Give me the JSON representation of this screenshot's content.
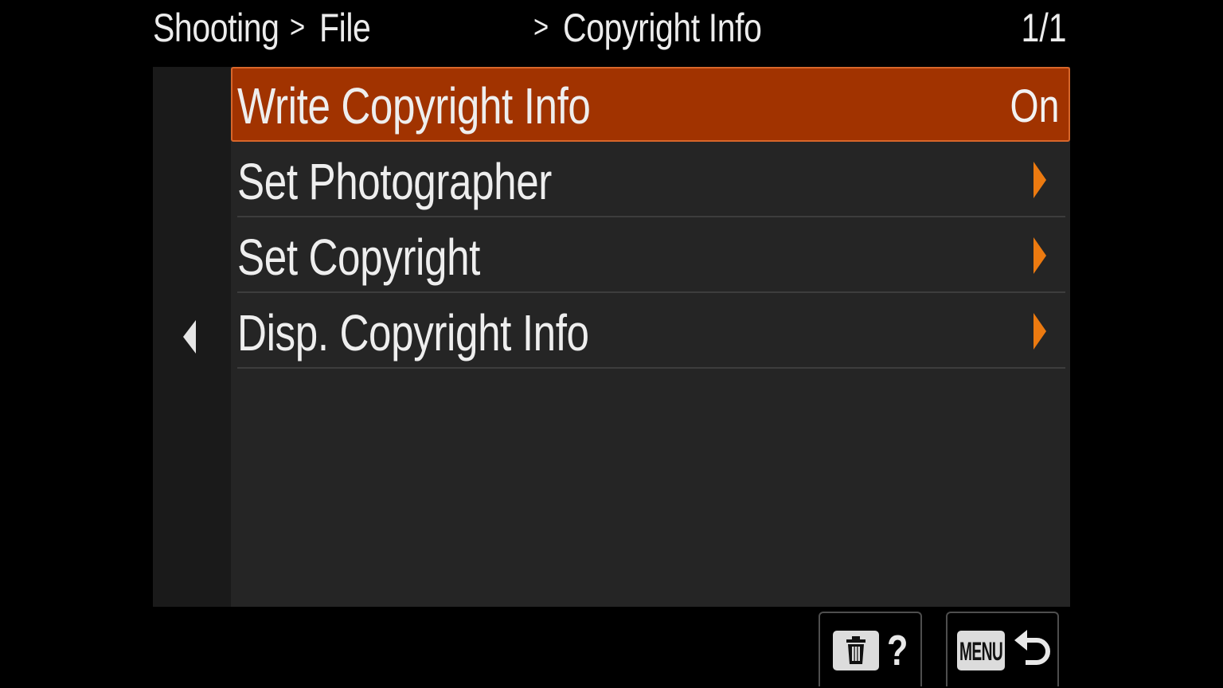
{
  "header": {
    "breadcrumb": [
      "Shooting",
      "File",
      "Copyright Info"
    ],
    "separator": ">",
    "page_indicator": "1/1"
  },
  "menu": {
    "items": [
      {
        "label": "Write Copyright Info",
        "value": "On",
        "selected": true
      },
      {
        "label": "Set Photographer",
        "has_submenu": true
      },
      {
        "label": "Set Copyright",
        "has_submenu": true
      },
      {
        "label": "Disp. Copyright Info",
        "has_submenu": true
      }
    ]
  },
  "footer": {
    "help_button": {
      "icon": "trash-icon",
      "label": "?"
    },
    "back_button": {
      "badge": "MENU",
      "icon": "return-icon"
    }
  },
  "colors": {
    "selected_bg": "#a13300",
    "selected_border": "#d8662a",
    "submenu_arrow": "#ec7a10",
    "panel_bg": "#252525",
    "background": "#000000"
  }
}
